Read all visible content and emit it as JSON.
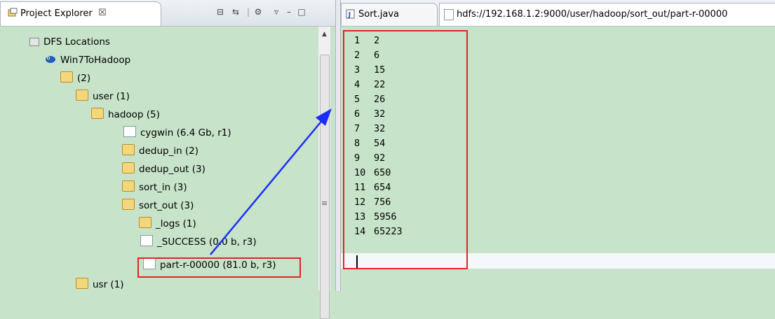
{
  "left_panel": {
    "tab_label": "Project Explorer",
    "tab_close": "☒",
    "tree": [
      {
        "label": "DFS Locations",
        "icon": "dfs-locations-icon"
      },
      {
        "label": "Win7ToHadoop",
        "icon": "hadoop-elephant-icon"
      },
      {
        "label": "(2)",
        "icon": "folder-icon"
      },
      {
        "label": "user (1)",
        "icon": "folder-icon"
      },
      {
        "label": "hadoop (5)",
        "icon": "folder-icon"
      },
      {
        "label": "cygwin (6.4 Gb, r1)",
        "icon": "file-icon"
      },
      {
        "label": "dedup_in (2)",
        "icon": "folder-icon"
      },
      {
        "label": "dedup_out (3)",
        "icon": "folder-icon"
      },
      {
        "label": "sort_in (3)",
        "icon": "folder-icon"
      },
      {
        "label": "sort_out (3)",
        "icon": "folder-icon"
      },
      {
        "label": "_logs (1)",
        "icon": "folder-icon"
      },
      {
        "label": "_SUCCESS (0.0 b, r3)",
        "icon": "file-icon"
      },
      {
        "label": "part-r-00000 (81.0 b, r3)",
        "icon": "file-icon"
      },
      {
        "label": "usr (1)",
        "icon": "folder-icon"
      }
    ]
  },
  "editor": {
    "tabs": [
      {
        "label": "Sort.java"
      },
      {
        "label": "hdfs://192.168.1.2:9000/user/hadoop/sort_out/part-r-00000"
      }
    ],
    "lines": [
      {
        "key": "1",
        "value": "2"
      },
      {
        "key": "2",
        "value": "6"
      },
      {
        "key": "3",
        "value": "15"
      },
      {
        "key": "4",
        "value": "22"
      },
      {
        "key": "5",
        "value": "26"
      },
      {
        "key": "6",
        "value": "32"
      },
      {
        "key": "7",
        "value": "32"
      },
      {
        "key": "8",
        "value": "54"
      },
      {
        "key": "9",
        "value": "92"
      },
      {
        "key": "10",
        "value": "650"
      },
      {
        "key": "11",
        "value": "654"
      },
      {
        "key": "12",
        "value": "756"
      },
      {
        "key": "13",
        "value": "5956"
      },
      {
        "key": "14",
        "value": "65223"
      }
    ]
  },
  "colors": {
    "background": "#c7e3c9",
    "highlight_box": "#e02424",
    "arrow": "#1a2cff"
  }
}
